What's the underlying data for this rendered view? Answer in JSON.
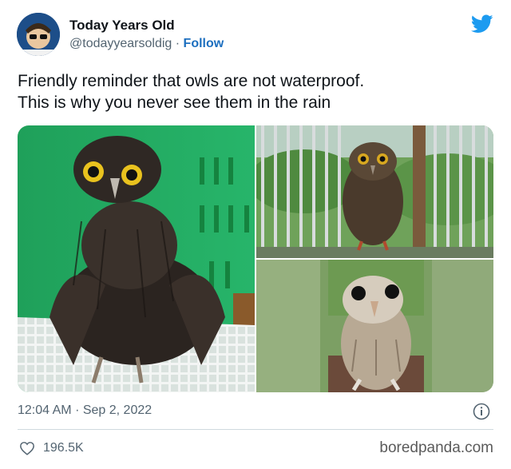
{
  "tweet": {
    "author_name": "Today Years Old",
    "author_handle": "@todayyearsoldig",
    "separator": "·",
    "follow_label": "Follow",
    "text_lines": [
      "Friendly reminder that owls are not waterproof.",
      "This is why you never see them in the rain"
    ],
    "time": "12:04 AM",
    "date": "Sep 2, 2022",
    "likes": "196.5K"
  },
  "source_credit": "boredpanda.com",
  "icons": {
    "brand": "twitter-bird-icon",
    "info": "info-icon",
    "like": "heart-icon"
  },
  "colors": {
    "follow": "#1d6fbf",
    "twitter_blue": "#1d9bf0",
    "muted_text": "#536471"
  }
}
